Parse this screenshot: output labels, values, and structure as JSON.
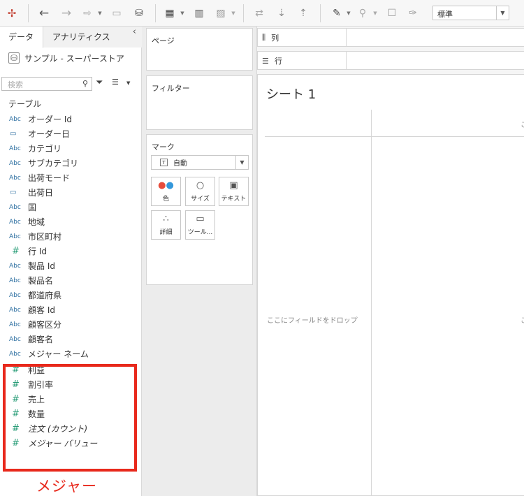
{
  "toolbar": {
    "icons": [
      "tableau-logo-icon",
      "undo-icon",
      "redo-icon",
      "replay-icon",
      "save-icon",
      "new-datasource-icon",
      "new-worksheet-icon",
      "duplicate-chart-icon",
      "clear-sheet-icon",
      "swap-icon",
      "sort-asc-icon",
      "sort-desc-icon",
      "highlight-icon",
      "group-icon",
      "label-icon",
      "pin-icon"
    ],
    "view_select": "標準"
  },
  "data_pane": {
    "tabs": [
      "データ",
      "アナリティクス"
    ],
    "datasource": "サンプル - スーパーストア",
    "search_placeholder": "検索",
    "table_header": "テーブル",
    "dimensions": [
      {
        "type": "Abc",
        "name": "オーダー Id"
      },
      {
        "type": "cal",
        "name": "オーダー日"
      },
      {
        "type": "Abc",
        "name": "カテゴリ"
      },
      {
        "type": "Abc",
        "name": "サブカテゴリ"
      },
      {
        "type": "Abc",
        "name": "出荷モード"
      },
      {
        "type": "cal",
        "name": "出荷日"
      },
      {
        "type": "Abc",
        "name": "国"
      },
      {
        "type": "Abc",
        "name": "地域"
      },
      {
        "type": "Abc",
        "name": "市区町村"
      },
      {
        "type": "#",
        "name": "行 Id"
      },
      {
        "type": "Abc",
        "name": "製品 Id"
      },
      {
        "type": "Abc",
        "name": "製品名"
      },
      {
        "type": "Abc",
        "name": "都道府県"
      },
      {
        "type": "Abc",
        "name": "顧客 Id"
      },
      {
        "type": "Abc",
        "name": "顧客区分"
      },
      {
        "type": "Abc",
        "name": "顧客名"
      },
      {
        "type": "Abc",
        "name": "メジャー ネーム"
      }
    ],
    "measures": [
      {
        "type": "#",
        "name": "利益"
      },
      {
        "type": "#",
        "name": "割引率"
      },
      {
        "type": "#",
        "name": "売上"
      },
      {
        "type": "#",
        "name": "数量"
      },
      {
        "type": "#",
        "name": "注文 (カウント)",
        "italic": true
      },
      {
        "type": "#",
        "name": "メジャー バリュー",
        "italic": true
      }
    ],
    "annotation_label": "メジャー",
    "annotation_color": "#e8291c"
  },
  "cards": {
    "pages": "ページ",
    "filters": "フィルター",
    "marks": {
      "title": "マーク",
      "type": "自動",
      "buttons": [
        "色",
        "サイズ",
        "テキスト",
        "詳細",
        "ツール..."
      ]
    }
  },
  "shelves": {
    "columns": "列",
    "rows": "行"
  },
  "sheet": {
    "title": "シート 1",
    "drop_hint": "ここにフィールドをドロップ",
    "edge_chars": [
      "こ",
      "こ"
    ]
  }
}
